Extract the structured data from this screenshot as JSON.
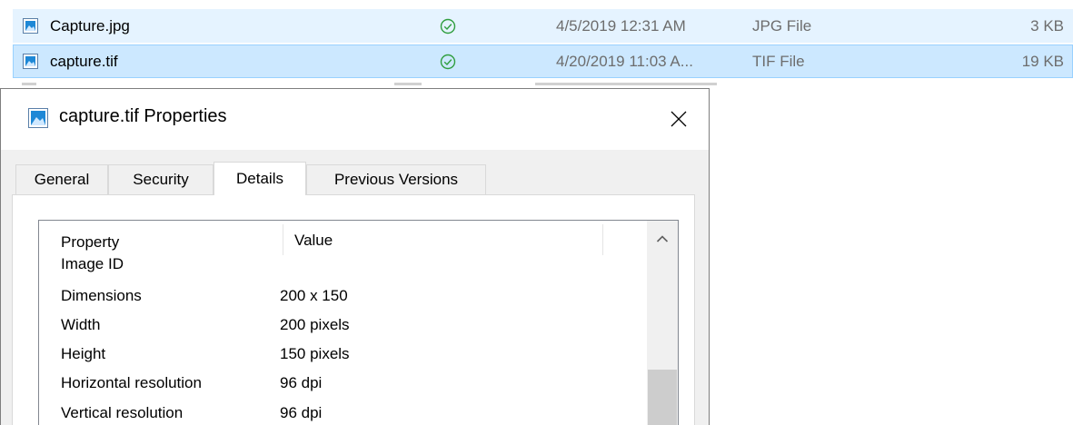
{
  "files": [
    {
      "name": "Capture.jpg",
      "date": "4/5/2019 12:31 AM",
      "type": "JPG File",
      "size": "3 KB",
      "selected": false
    },
    {
      "name": "capture.tif",
      "date": "4/20/2019 11:03 A...",
      "type": "TIF File",
      "size": "19 KB",
      "selected": true
    }
  ],
  "dialog": {
    "title": "capture.tif Properties",
    "tabs": [
      "General",
      "Security",
      "Details",
      "Previous Versions"
    ],
    "active_tab": "Details",
    "columns": {
      "property": "Property",
      "value": "Value"
    },
    "rows": [
      {
        "name": "Image ID",
        "value": ""
      },
      {
        "name": "Dimensions",
        "value": "200 x 150"
      },
      {
        "name": "Width",
        "value": "200 pixels"
      },
      {
        "name": "Height",
        "value": "150 pixels"
      },
      {
        "name": "Horizontal resolution",
        "value": "96 dpi"
      },
      {
        "name": "Vertical resolution",
        "value": "96 dpi"
      }
    ]
  },
  "icons": {
    "file": "image-file-icon",
    "sync_status": "available-check-icon",
    "close": "close-icon",
    "scroll_up": "chevron-up-icon"
  },
  "colors": {
    "hover_row": "#e5f3ff",
    "selected_row": "#cce8ff",
    "status_green": "#2f9e3e",
    "dialog_bg": "#f0f0f0"
  }
}
